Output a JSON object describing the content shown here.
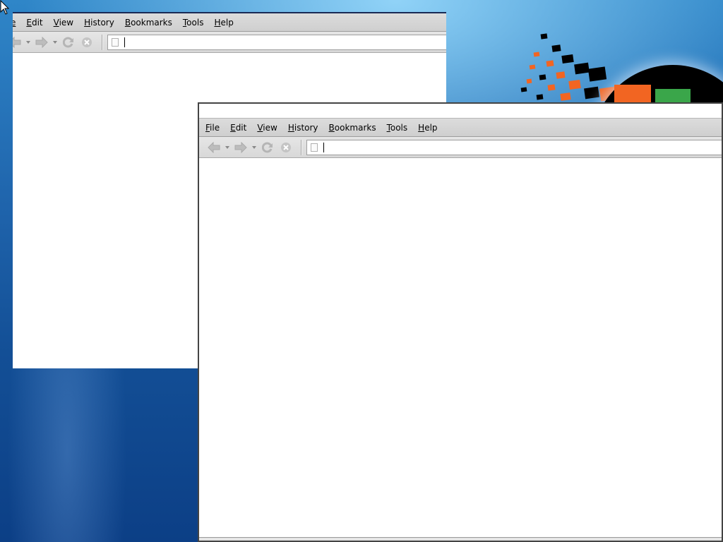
{
  "back_window": {
    "menu": [
      "e",
      "Edit",
      "View",
      "History",
      "Bookmarks",
      "Tools",
      "Help"
    ],
    "url_value": ""
  },
  "front_window": {
    "title": "",
    "menu": [
      "File",
      "Edit",
      "View",
      "History",
      "Bookmarks",
      "Tools",
      "Help"
    ],
    "url_value": ""
  },
  "icons": {
    "back": "back-arrow-icon",
    "forward": "forward-arrow-icon",
    "reload": "reload-icon",
    "stop": "stop-icon",
    "page": "page-icon",
    "cursor": "mouse-cursor-icon"
  },
  "colors": {
    "logo_orange": "#f26522",
    "logo_green": "#3aa64a",
    "desktop_blue": "#1f64ac"
  }
}
